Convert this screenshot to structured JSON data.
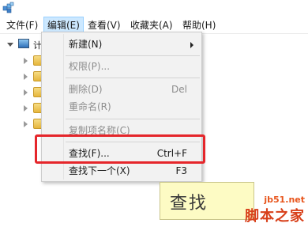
{
  "menubar": {
    "items": [
      {
        "label": "文件(F)"
      },
      {
        "label": "编辑(E)"
      },
      {
        "label": "查看(V)"
      },
      {
        "label": "收藏夹(A)"
      },
      {
        "label": "帮助(H)"
      }
    ]
  },
  "tree": {
    "root_label": "计",
    "child_count": 5
  },
  "context_menu": {
    "items": [
      {
        "label": "新建(N)",
        "shortcut": "",
        "enabled": true,
        "submenu": true
      },
      {
        "label": "权限(P)...",
        "shortcut": "",
        "enabled": false
      },
      {
        "label": "删除(D)",
        "shortcut": "Del",
        "enabled": false
      },
      {
        "label": "重命名(R)",
        "shortcut": "",
        "enabled": false
      },
      {
        "label": "复制项名称(C)",
        "shortcut": "",
        "enabled": false
      },
      {
        "label": "查找(F)...",
        "shortcut": "Ctrl+F",
        "enabled": true
      },
      {
        "label": "查找下一个(X)",
        "shortcut": "F3",
        "enabled": true
      }
    ]
  },
  "find_dialog_title": "查找",
  "watermark": {
    "url": "jb51.net",
    "name": "脚本之家"
  },
  "colors": {
    "highlight": "#e5262b",
    "menu_active": "#cce8ff"
  }
}
